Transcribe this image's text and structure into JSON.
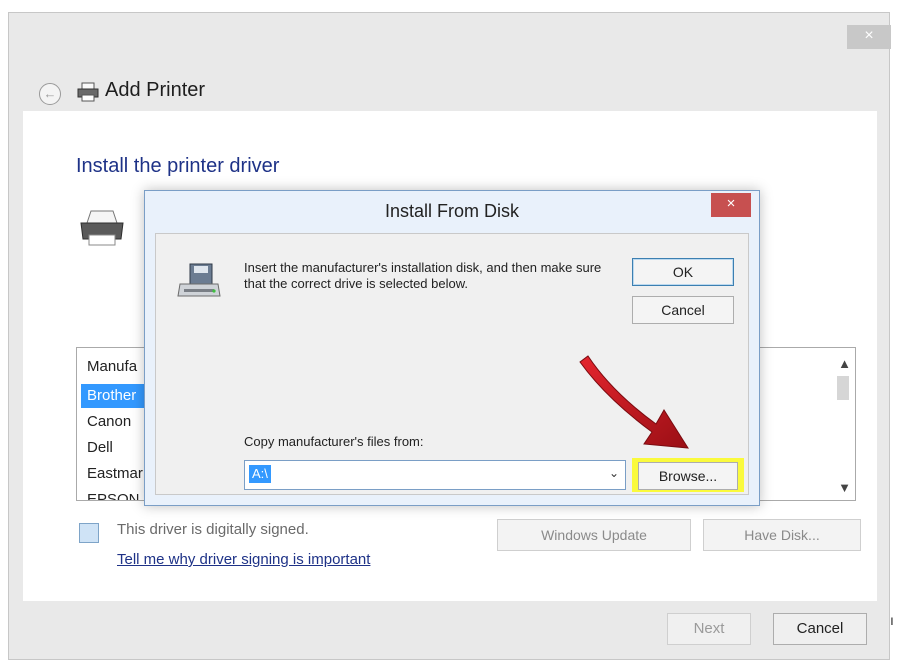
{
  "wizard": {
    "title": "Add Printer",
    "close_glyph": "×",
    "back_glyph": "←",
    "heading": "Install the printer driver",
    "manufacturers": {
      "header": "Manufa",
      "items": [
        "Brother",
        "Canon",
        "Dell",
        "Eastmar",
        "EPSON"
      ],
      "selected": "Brother"
    },
    "signed_text": "This driver is digitally signed.",
    "signing_link": "Tell me why driver signing is important",
    "windows_update_label": "Windows Update",
    "have_disk_label": "Have Disk...",
    "next_label": "Next",
    "cancel_label": "Cancel"
  },
  "dialog": {
    "title": "Install From Disk",
    "close_glyph": "×",
    "instruction": "Insert the manufacturer's installation disk, and then make sure that the correct drive is selected below.",
    "ok_label": "OK",
    "cancel_label": "Cancel",
    "copy_label": "Copy manufacturer's files from:",
    "path_value": "A:\\",
    "browse_label": "Browse..."
  },
  "icons": [
    "back-arrow-icon",
    "printer-icon",
    "disk-drive-icon",
    "certificate-icon",
    "close-icon",
    "chevron-down-icon"
  ],
  "colors": {
    "highlight": "#fafa3c",
    "selection": "#3399ff",
    "annotation_arrow": "#c0141c",
    "dialog_close": "#c75050"
  }
}
